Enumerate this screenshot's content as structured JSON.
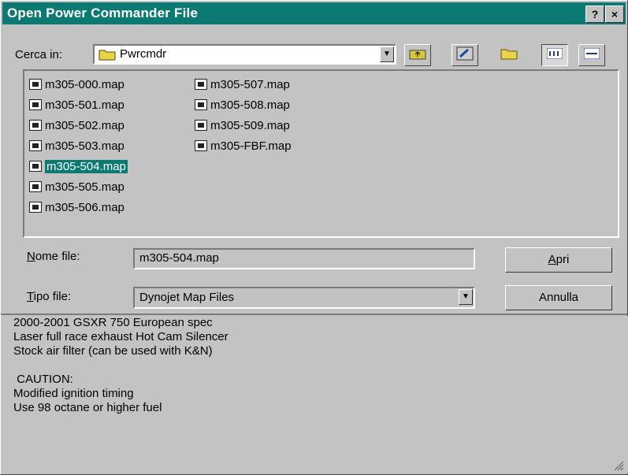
{
  "window": {
    "title": "Open Power Commander File",
    "help_label": "?",
    "close_label": "×"
  },
  "look_in": {
    "label": "Cerca in:",
    "value": "Pwrcmdr"
  },
  "toolbar": [
    {
      "name": "up-folder-icon"
    },
    {
      "name": "desktop-icon"
    },
    {
      "name": "new-folder-icon"
    },
    {
      "name": "list-view-icon"
    },
    {
      "name": "details-view-icon"
    }
  ],
  "files": [
    {
      "name": "m305-000.map",
      "selected": false
    },
    {
      "name": "m305-501.map",
      "selected": false
    },
    {
      "name": "m305-502.map",
      "selected": false
    },
    {
      "name": "m305-503.map",
      "selected": false
    },
    {
      "name": "m305-504.map",
      "selected": true
    },
    {
      "name": "m305-505.map",
      "selected": false
    },
    {
      "name": "m305-506.map",
      "selected": false
    },
    {
      "name": "m305-507.map",
      "selected": false
    },
    {
      "name": "m305-508.map",
      "selected": false
    },
    {
      "name": "m305-509.map",
      "selected": false
    },
    {
      "name": "m305-FBF.map",
      "selected": false
    }
  ],
  "filename": {
    "label_u": "N",
    "label_rest": "ome file:",
    "value": "m305-504.map"
  },
  "filetype": {
    "label_u": "T",
    "label_rest": "ipo file:",
    "value": "Dynojet Map Files"
  },
  "buttons": {
    "open_u": "A",
    "open_rest": "pri",
    "cancel": "Annulla"
  },
  "description": "2000-2001 GSXR 750 European spec\nLaser full race exhaust Hot Cam Silencer\nStock air filter (can be used with K&N)\n\n CAUTION:\nModified ignition timing\nUse 98 octane or higher fuel"
}
